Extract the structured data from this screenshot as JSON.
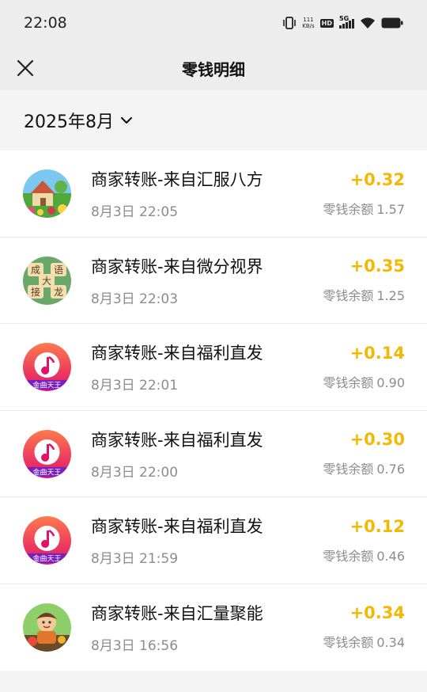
{
  "status_bar": {
    "time": "22:08",
    "net_speed_value": "111",
    "net_speed_unit": "KB/s",
    "hd_label": "HD",
    "network_label": "5G"
  },
  "nav": {
    "title": "零钱明细",
    "close_icon": "close-icon"
  },
  "filter": {
    "month": "2025年8月",
    "dropdown_icon": "chevron-down-icon"
  },
  "colors": {
    "amount": "#f5b800",
    "secondary_text": "#8c8c8c"
  },
  "transactions": [
    {
      "title": "商家转账-来自汇服八方",
      "time": "8月3日 22:05",
      "amount": "+0.32",
      "balance_label": "零钱余额",
      "balance": "1.57",
      "avatar": "garden-avatar"
    },
    {
      "title": "商家转账-来自微分视界",
      "time": "8月3日 22:03",
      "amount": "+0.35",
      "balance_label": "零钱余额",
      "balance": "1.25",
      "avatar": "idiom-tiles-avatar"
    },
    {
      "title": "商家转账-来自福利直发",
      "time": "8月3日 22:01",
      "amount": "+0.14",
      "balance_label": "零钱余额",
      "balance": "0.90",
      "avatar": "music-note-avatar"
    },
    {
      "title": "商家转账-来自福利直发",
      "time": "8月3日 22:00",
      "amount": "+0.30",
      "balance_label": "零钱余额",
      "balance": "0.76",
      "avatar": "music-note-avatar"
    },
    {
      "title": "商家转账-来自福利直发",
      "time": "8月3日 21:59",
      "amount": "+0.12",
      "balance_label": "零钱余额",
      "balance": "0.46",
      "avatar": "music-note-avatar"
    },
    {
      "title": "商家转账-来自汇量聚能",
      "time": "8月3日 16:56",
      "amount": "+0.34",
      "balance_label": "零钱余额",
      "balance": "0.34",
      "avatar": "farmer-avatar"
    }
  ],
  "avatar_text": {
    "idiom_tiles": [
      "成",
      "语",
      "大",
      "接",
      "龙"
    ],
    "music_badge": "金曲天王"
  }
}
